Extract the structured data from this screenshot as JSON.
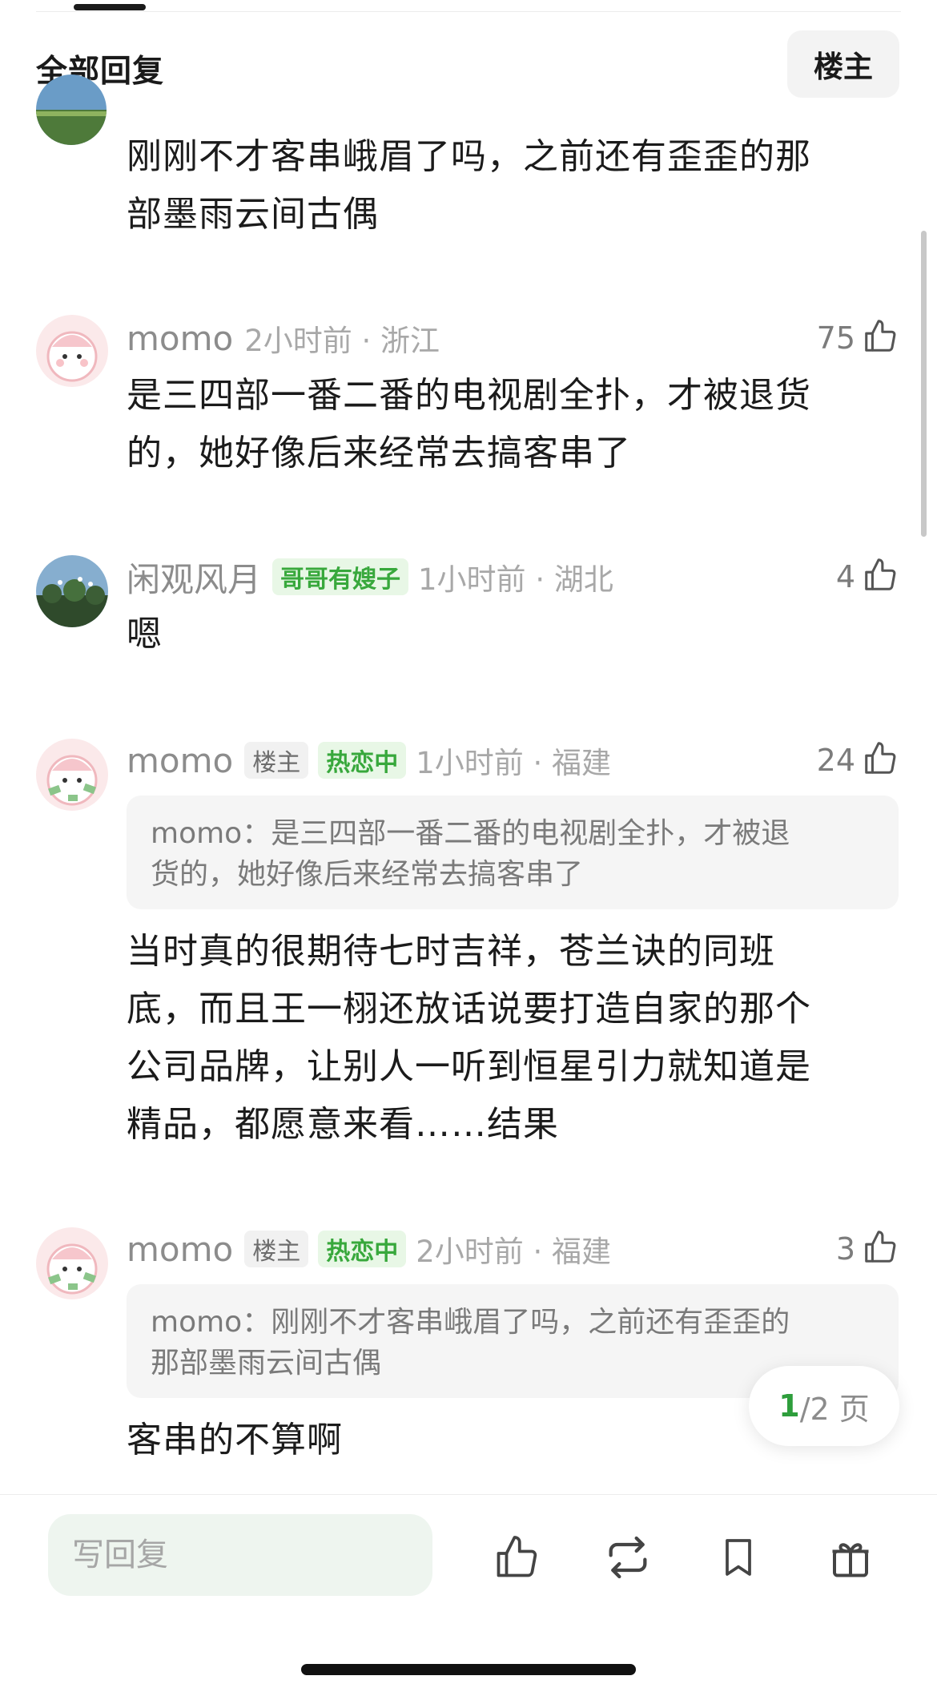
{
  "header": {
    "title": "全部回复",
    "op_filter_label": "楼主"
  },
  "comments": [
    {
      "text_lines": [
        "刚刚不才客串峨眉了吗，之前还有歪歪的那",
        "部墨雨云间古偶"
      ]
    },
    {
      "username": "momo",
      "time_loc": "2小时前 · 浙江",
      "likes": "75",
      "text_lines": [
        "是三四部一番二番的电视剧全扑，才被退货",
        "的，她好像后来经常去搞客串了"
      ]
    },
    {
      "username": "闲观风月",
      "badge": "哥哥有嫂子",
      "time_loc": "1小时前 · 湖北",
      "likes": "4",
      "text_lines": [
        "嗯"
      ]
    },
    {
      "username": "momo",
      "badge_op": "楼主",
      "badge_status": "热恋中",
      "time_loc": "1小时前 · 福建",
      "likes": "24",
      "quote_lines": [
        "momo：是三四部一番二番的电视剧全扑，才被退",
        "货的，她好像后来经常去搞客串了"
      ],
      "text_lines": [
        "当时真的很期待七时吉祥，苍兰诀的同班",
        "底，而且王一栩还放话说要打造自家的那个",
        "公司品牌，让别人一听到恒星引力就知道是",
        "精品，都愿意来看……结果"
      ]
    },
    {
      "username": "momo",
      "badge_op": "楼主",
      "badge_status": "热恋中",
      "time_loc": "2小时前 · 福建",
      "likes": "3",
      "quote_lines": [
        "momo：刚刚不才客串峨眉了吗，之前还有歪歪的",
        "那部墨雨云间古偶"
      ],
      "text_lines": [
        "客串的不算啊"
      ]
    }
  ],
  "pager": {
    "current": "1",
    "total_suffix": "/2 页"
  },
  "bottom_bar": {
    "reply_placeholder": "写回复",
    "icons": [
      "thumb-up-icon",
      "repost-icon",
      "bookmark-icon",
      "gift-icon"
    ]
  },
  "colors": {
    "accent_green": "#2e9e3c",
    "badge_green_bg": "#e8f7e6",
    "meta_gray": "#8c8c8c"
  }
}
